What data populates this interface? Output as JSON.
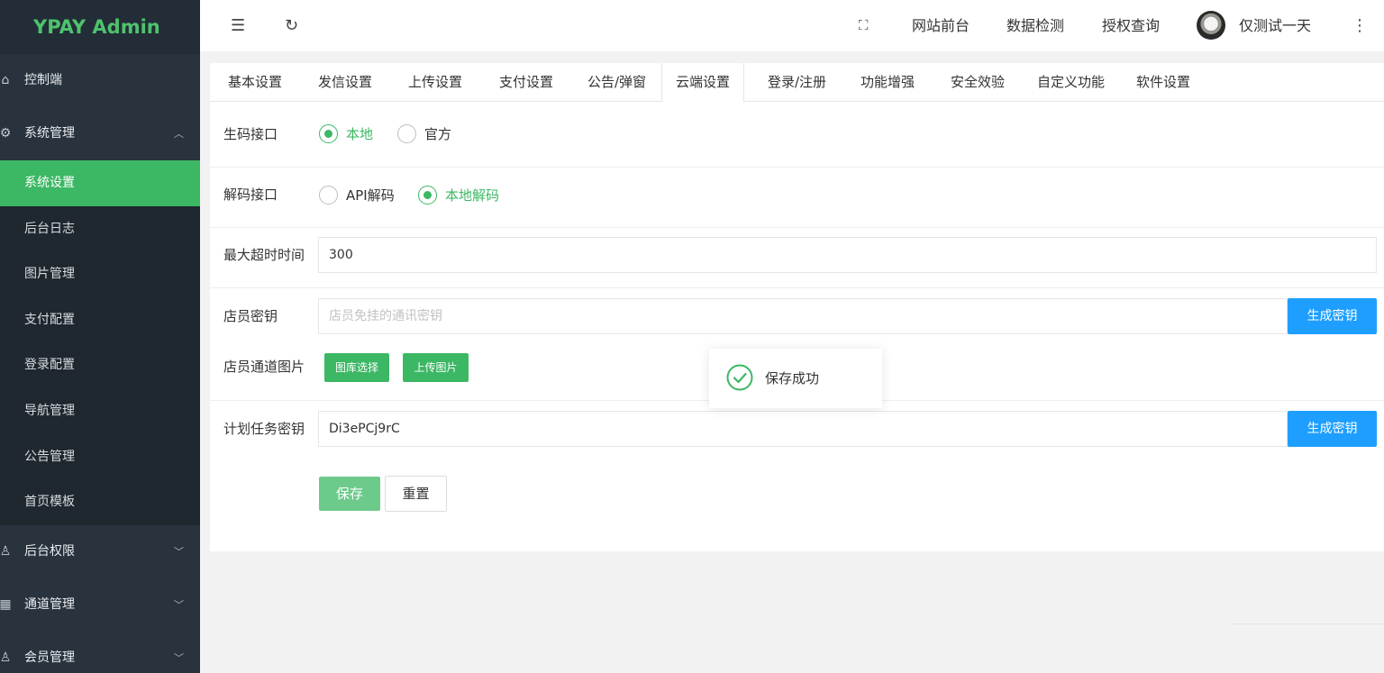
{
  "app": {
    "logo": "YPAY Admin",
    "brand_color": "#4ec36d"
  },
  "sidebar": {
    "items": [
      {
        "icon": "home-icon",
        "label": "控制端"
      },
      {
        "icon": "gear-icon",
        "label": "系统管理",
        "expanded": true,
        "children": [
          "系统设置",
          "后台日志",
          "图片管理",
          "支付配置",
          "登录配置",
          "导航管理",
          "公告管理",
          "首页模板"
        ],
        "active_child": "系统设置"
      },
      {
        "icon": "user-icon",
        "label": "后台权限"
      },
      {
        "icon": "apps-icon",
        "label": "通道管理"
      },
      {
        "icon": "user-icon",
        "label": "会员管理"
      }
    ]
  },
  "header": {
    "links": [
      "网站前台",
      "数据检测",
      "授权查询"
    ],
    "username": "仅测试一天",
    "icons": [
      "menu-toggle-icon",
      "refresh-icon",
      "fullscreen-icon",
      "more-vertical-icon"
    ]
  },
  "tabs": {
    "items": [
      "基本设置",
      "发信设置",
      "上传设置",
      "支付设置",
      "公告/弹窗",
      "云端设置",
      "登录/注册",
      "功能增强",
      "安全效验",
      "自定义功能",
      "软件设置"
    ],
    "active": "云端设置"
  },
  "form": {
    "code_api": {
      "label": "生码接口",
      "options": [
        "本地",
        "官方"
      ],
      "selected": "本地"
    },
    "decode_api": {
      "label": "解码接口",
      "options": [
        "API解码",
        "本地解码"
      ],
      "selected": "本地解码"
    },
    "timeout": {
      "label": "最大超时时间",
      "value": "300"
    },
    "clerk_key": {
      "label": "店员密钥",
      "value": "",
      "placeholder": "店员免挂的通讯密钥",
      "button": "生成密钥"
    },
    "clerk_image": {
      "label": "店员通道图片",
      "buttons": [
        "图库选择",
        "上传图片"
      ]
    },
    "cron_key": {
      "label": "计划任务密钥",
      "value": "Di3ePCj9rC",
      "button": "生成密钥"
    },
    "save_label": "保存",
    "reset_label": "重置"
  },
  "toast": {
    "message": "保存成功",
    "icon": "check-circle-icon"
  },
  "colors": {
    "accent_green": "#3cb764",
    "button_blue": "#1e9fff",
    "sidebar_bg": "#28333e"
  }
}
